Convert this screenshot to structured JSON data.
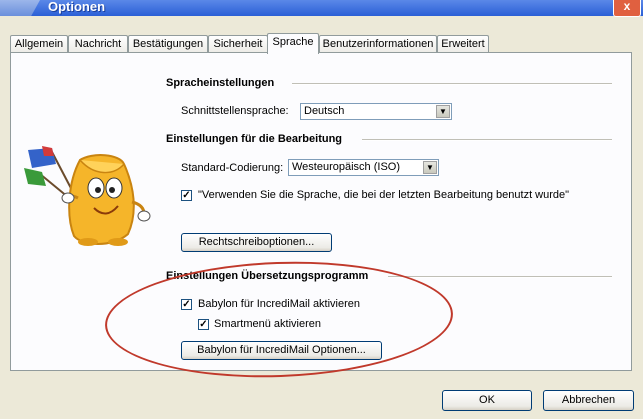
{
  "window": {
    "title": "Optionen",
    "close_label": "x"
  },
  "tabs": [
    {
      "label": "Allgemein"
    },
    {
      "label": "Nachricht"
    },
    {
      "label": "Bestätigungen"
    },
    {
      "label": "Sicherheit"
    },
    {
      "label": "Sprache"
    },
    {
      "label": "Benutzerinformationen"
    },
    {
      "label": "Erweitert"
    }
  ],
  "language": {
    "section_title": "Spracheinstellungen",
    "interface_label": "Schnittstellensprache:",
    "interface_value": "Deutsch"
  },
  "editing": {
    "section_title": "Einstellungen für die Bearbeitung",
    "encoding_label": "Standard-Codierung:",
    "encoding_value": "Westeuropäisch (ISO)",
    "use_last_language_label": "\"Verwenden Sie die Sprache, die bei der letzten Bearbeitung benutzt wurde\"",
    "use_last_language_checked": true,
    "spellcheck_button": "Rechtschreiboptionen..."
  },
  "translation": {
    "section_title": "Einstellungen Übersetzungsprogramm",
    "babylon_label": "Babylon für IncrediMail aktivieren",
    "babylon_checked": true,
    "smartmenu_label": "Smartmenü aktivieren",
    "smartmenu_checked": true,
    "babylon_options_button": "Babylon für IncrediMail Optionen..."
  },
  "footer": {
    "ok_label": "OK",
    "cancel_label": "Abbrechen"
  },
  "colors": {
    "highlight_oval": "#c0392b",
    "title_bar": "#2a5fd6"
  }
}
